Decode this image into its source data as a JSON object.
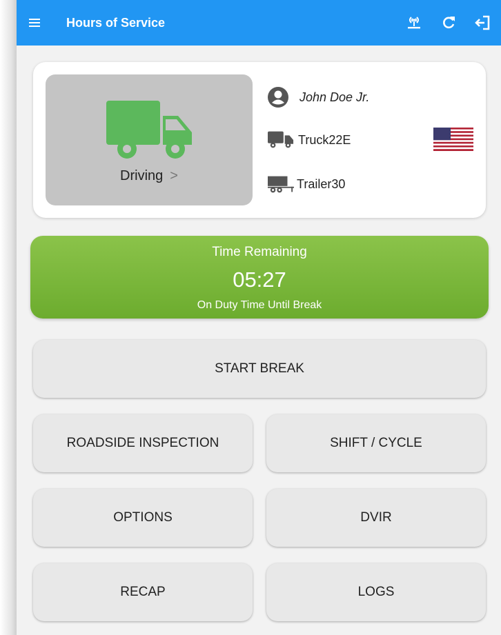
{
  "appbar": {
    "title": "Hours of Service",
    "icons": [
      "menu-icon",
      "bluetooth-signal-icon",
      "refresh-icon",
      "logout-icon"
    ]
  },
  "status_card": {
    "status_label": "Driving",
    "chevron": ">",
    "driver_name": "John Doe Jr.",
    "truck": "Truck22E",
    "trailer": "Trailer30",
    "flag": "us-flag",
    "status_color": "#5cb85c"
  },
  "timer": {
    "heading": "Time Remaining",
    "value": "05:27",
    "subtitle": "On Duty Time Until Break",
    "color": "#7cb342"
  },
  "buttons": {
    "start_break": "START BREAK",
    "roadside_inspection": "ROADSIDE INSPECTION",
    "shift_cycle": "SHIFT / CYCLE",
    "options": "OPTIONS",
    "dvir": "DVIR",
    "recap": "RECAP",
    "logs": "LOGS"
  },
  "colors": {
    "appbar": "#2196f3",
    "background": "#f2f2f2",
    "button": "#e8e8e8"
  }
}
